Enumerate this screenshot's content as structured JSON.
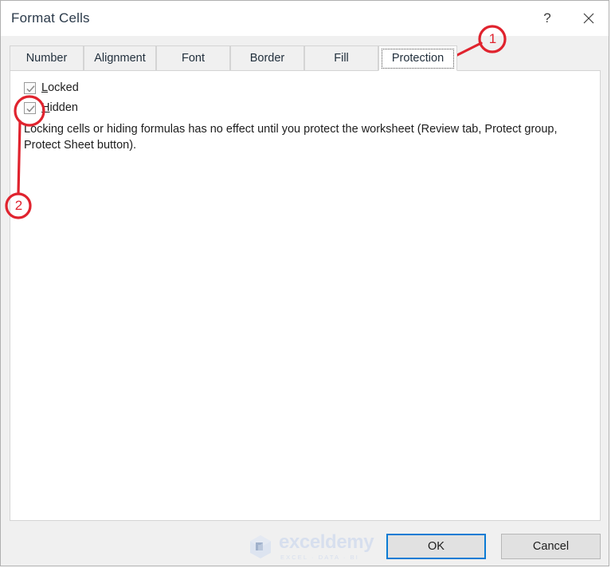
{
  "window": {
    "title": "Format Cells",
    "help_icon": "?",
    "help_icon_name": "help-icon",
    "close_icon": "×",
    "close_icon_name": "close-icon"
  },
  "tabs": [
    {
      "label": "Number",
      "selected": false
    },
    {
      "label": "Alignment",
      "selected": false
    },
    {
      "label": "Font",
      "selected": false
    },
    {
      "label": "Border",
      "selected": false
    },
    {
      "label": "Fill",
      "selected": false
    },
    {
      "label": "Protection",
      "selected": true
    }
  ],
  "protection": {
    "locked": {
      "label": "Locked",
      "accelerator": "L",
      "rest": "ocked",
      "checked": true
    },
    "hidden": {
      "label": "Hidden",
      "accelerator": "H",
      "rest": "idden",
      "checked": true
    },
    "description": "Locking cells or hiding formulas has no effect until you protect the worksheet (Review tab, Protect group, Protect Sheet button)."
  },
  "footer": {
    "ok_label": "OK",
    "cancel_label": "Cancel"
  },
  "watermark": {
    "name": "exceldemy",
    "tagline": "EXCEL · DATA · BI"
  },
  "annotations": {
    "color": "#e0232e",
    "callouts": [
      {
        "number": "1",
        "target": "protection-tab"
      },
      {
        "number": "2",
        "target": "hidden-checkbox"
      }
    ]
  }
}
